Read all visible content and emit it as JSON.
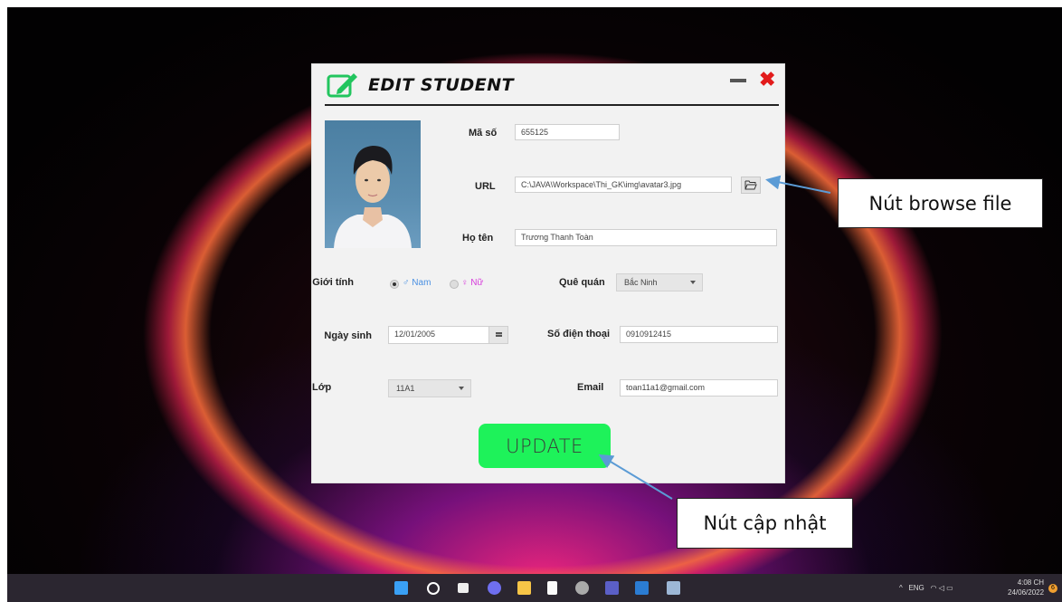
{
  "dialog": {
    "title": "EDIT STUDENT",
    "close_symbol": "✖",
    "fields": {
      "ma_so": {
        "label": "Mã số",
        "value": "655125"
      },
      "url": {
        "label": "URL",
        "value": "C:\\JAVA\\Workspace\\Thi_GK\\img\\avatar3.jpg"
      },
      "ho_ten": {
        "label": "Họ tên",
        "value": "Trương Thanh Toàn"
      },
      "gioi_tinh": {
        "label": "Giới tính",
        "options": [
          {
            "symbol": "♂",
            "text": "Nam",
            "checked": true,
            "color": "#4a90e2"
          },
          {
            "symbol": "♀",
            "text": "Nữ",
            "checked": false,
            "color": "#d63adb"
          }
        ]
      },
      "que_quan": {
        "label": "Quê quán",
        "value": "Bắc Ninh"
      },
      "ngay_sinh": {
        "label": "Ngày sinh",
        "value": "12/01/2005"
      },
      "so_dien_thoai": {
        "label": "Số điện thoại",
        "value": "0910912415"
      },
      "lop": {
        "label": "Lớp",
        "value": "11A1"
      },
      "email": {
        "label": "Email",
        "value": "toan11a1@gmail.com"
      }
    },
    "update_label": "UPDATE",
    "accent_color": "#1ef25a"
  },
  "callouts": {
    "browse": "Nút browse file",
    "update": "Nút cập nhật"
  },
  "taskbar": {
    "icons": [
      "windows-start-icon",
      "search-icon",
      "task-view-icon",
      "chat-icon",
      "file-explorer-icon",
      "notepad-icon",
      "settings-icon",
      "teams-icon",
      "word-icon",
      "java-app-icon"
    ],
    "tray_language": "ENG",
    "time": "4:08 CH",
    "date": "24/06/2022",
    "notification_count": "6"
  }
}
